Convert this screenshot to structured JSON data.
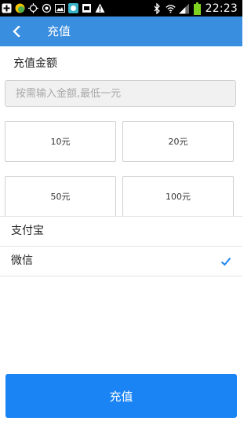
{
  "status_bar": {
    "time": "22:23",
    "icons": [
      "add-icon",
      "app-icon",
      "location-icon",
      "sync-icon",
      "image-icon",
      "app-icon",
      "sim-icon",
      "warning-icon",
      "bluetooth-icon",
      "wifi-icon",
      "signal-icon",
      "battery-icon"
    ]
  },
  "header": {
    "title": "充值",
    "back_icon": "chevron-left-icon"
  },
  "amount": {
    "label": "充值金额",
    "placeholder": "按需输入金额,最低一元",
    "value": ""
  },
  "presets": [
    {
      "label": "10元"
    },
    {
      "label": "20元"
    },
    {
      "label": "50元"
    },
    {
      "label": "100元"
    }
  ],
  "payment_methods": [
    {
      "label": "支付宝",
      "selected": false
    },
    {
      "label": "微信",
      "selected": true
    }
  ],
  "submit": {
    "label": "充值"
  },
  "colors": {
    "app_bar": "#3a8ee0",
    "button": "#1a84f5",
    "check": "#1a84f5",
    "status_bar": "#000000",
    "battery": "#7ed321"
  }
}
